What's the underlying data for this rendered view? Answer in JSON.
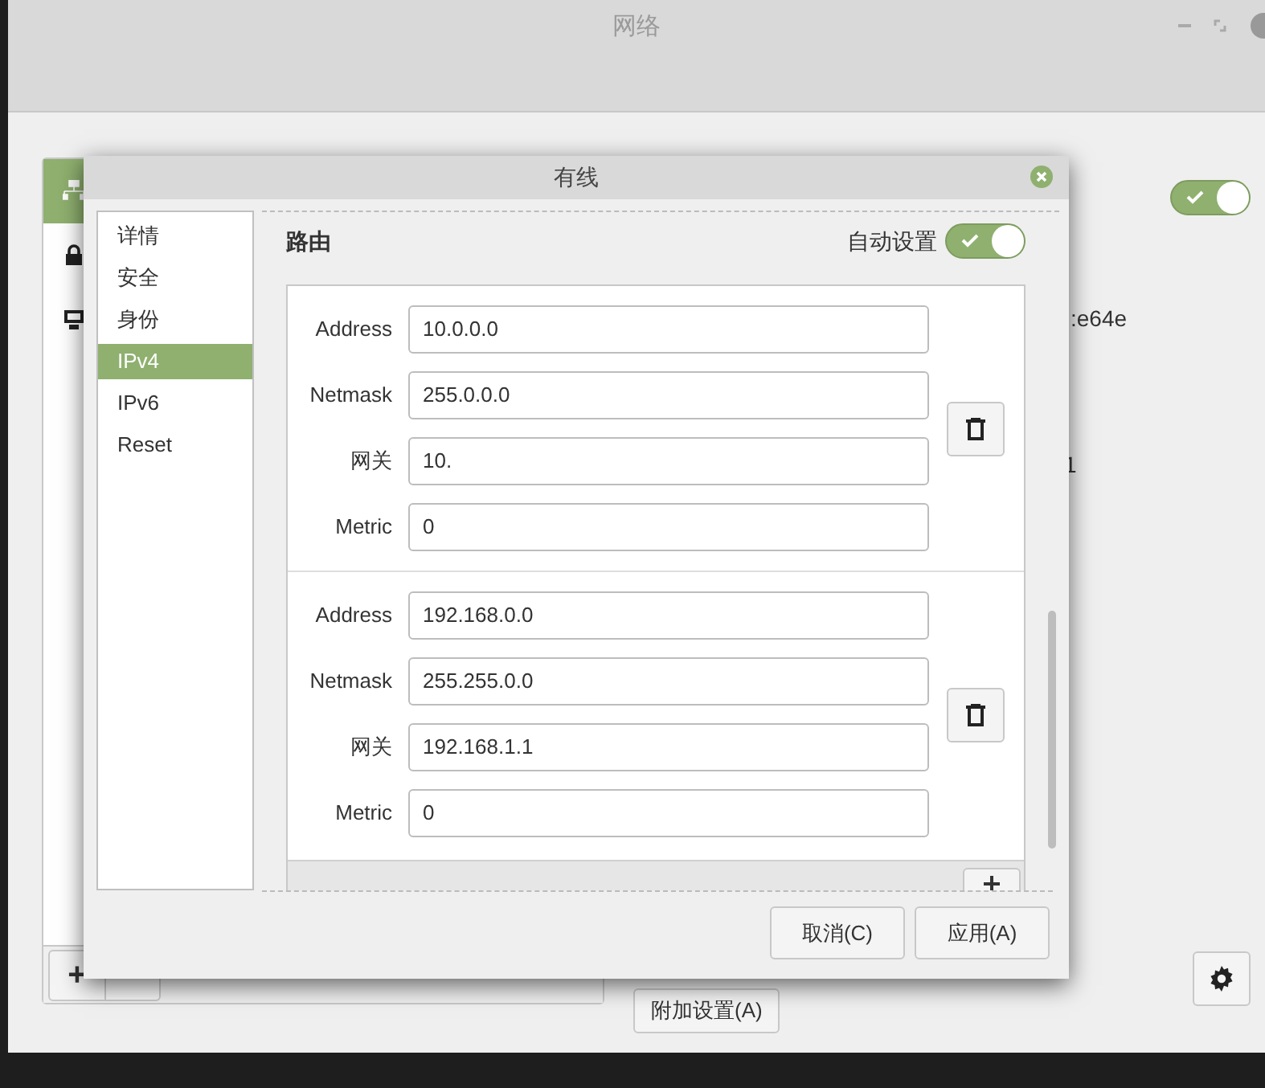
{
  "window": {
    "title": "网络"
  },
  "sidebar": {
    "items": [
      {
        "kind": "network",
        "selected": true
      },
      {
        "kind": "lock",
        "selected": false
      },
      {
        "kind": "computer",
        "selected": false
      }
    ],
    "add_button": "+"
  },
  "main": {
    "enabled": true,
    "details": [
      ":e64e",
      "1"
    ],
    "extra_button": "附加设置(A)"
  },
  "dialog": {
    "title": "有线",
    "nav": [
      {
        "label": "详情",
        "selected": false
      },
      {
        "label": "安全",
        "selected": false
      },
      {
        "label": "身份",
        "selected": false
      },
      {
        "label": "IPv4",
        "selected": true
      },
      {
        "label": "IPv6",
        "selected": false
      },
      {
        "label": "Reset",
        "selected": false
      }
    ],
    "section": "路由",
    "auto_label": "自动设置",
    "auto": true,
    "routes": [
      {
        "fields": [
          {
            "label": "Address",
            "value": "10.0.0.0"
          },
          {
            "label": "Netmask",
            "value": "255.0.0.0"
          },
          {
            "label": "网关",
            "value": "10."
          },
          {
            "label": "Metric",
            "value": "0"
          }
        ]
      },
      {
        "fields": [
          {
            "label": "Address",
            "value": "192.168.0.0"
          },
          {
            "label": "Netmask",
            "value": "255.255.0.0"
          },
          {
            "label": "网关",
            "value": "192.168.1.1"
          },
          {
            "label": "Metric",
            "value": "0"
          }
        ]
      }
    ],
    "buttons": [
      "取消(C)",
      "应用(A)"
    ]
  }
}
